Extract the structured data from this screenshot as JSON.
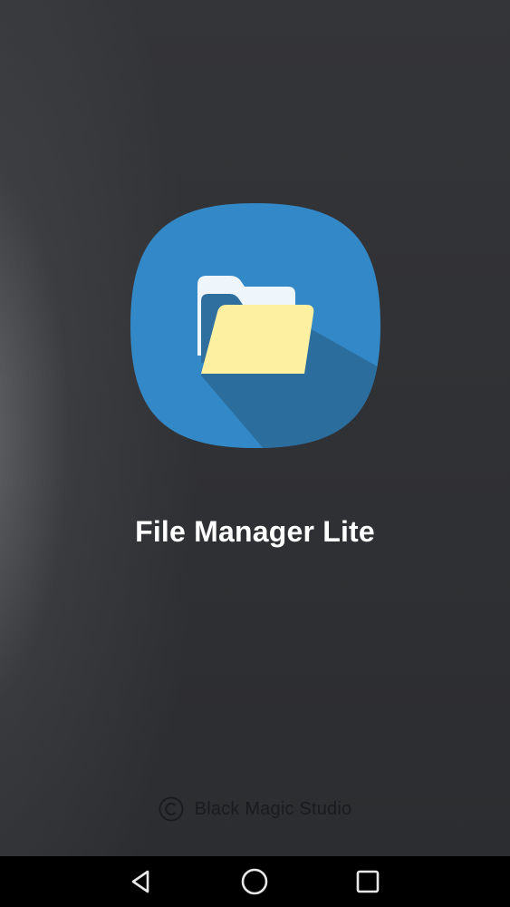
{
  "app": {
    "title": "File Manager Lite",
    "copyright_text": "Black Magic Studio"
  },
  "icons": {
    "app_icon": "folder-open-icon",
    "copyright": "copyright-icon",
    "nav_back": "back-triangle-icon",
    "nav_home": "home-circle-icon",
    "nav_recents": "recents-square-icon"
  },
  "colors": {
    "background": "#2f3033",
    "icon_blue": "#3389c7",
    "icon_shadow": "#2b6e9e",
    "folder_yellow": "#fdf0a0",
    "folder_back": "#eef6fc",
    "title_text": "#ffffff",
    "navbar": "#000000"
  }
}
